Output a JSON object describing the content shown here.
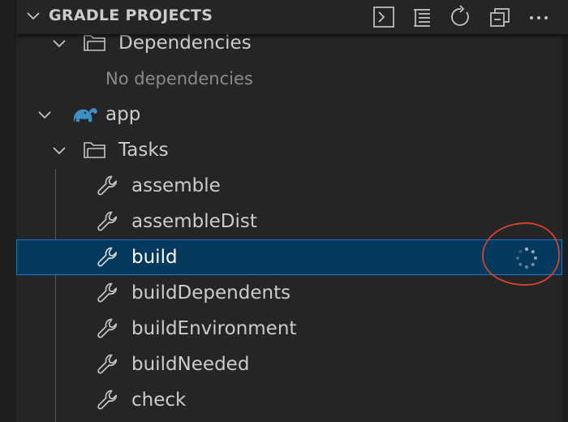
{
  "header": {
    "title": "GRADLE PROJECTS",
    "actions": [
      "terminal-icon",
      "collapse-list-icon",
      "refresh-icon",
      "collapse-all-icon",
      "more-icon"
    ]
  },
  "tree": {
    "dependencies_label": "Dependencies",
    "no_dependencies_label": "No dependencies",
    "project_label": "app",
    "tasks_label": "Tasks",
    "tasks": [
      {
        "label": "assemble"
      },
      {
        "label": "assembleDist"
      },
      {
        "label": "build"
      },
      {
        "label": "buildDependents"
      },
      {
        "label": "buildEnvironment"
      },
      {
        "label": "buildNeeded"
      },
      {
        "label": "check"
      }
    ],
    "selected_task": "build",
    "running_task": "build"
  },
  "colors": {
    "background": "#252526",
    "selection": "#04395e",
    "selection_border": "#0e7ad3",
    "gradle_elephant": "#3b8fc4",
    "annotation": "#d8432e"
  }
}
